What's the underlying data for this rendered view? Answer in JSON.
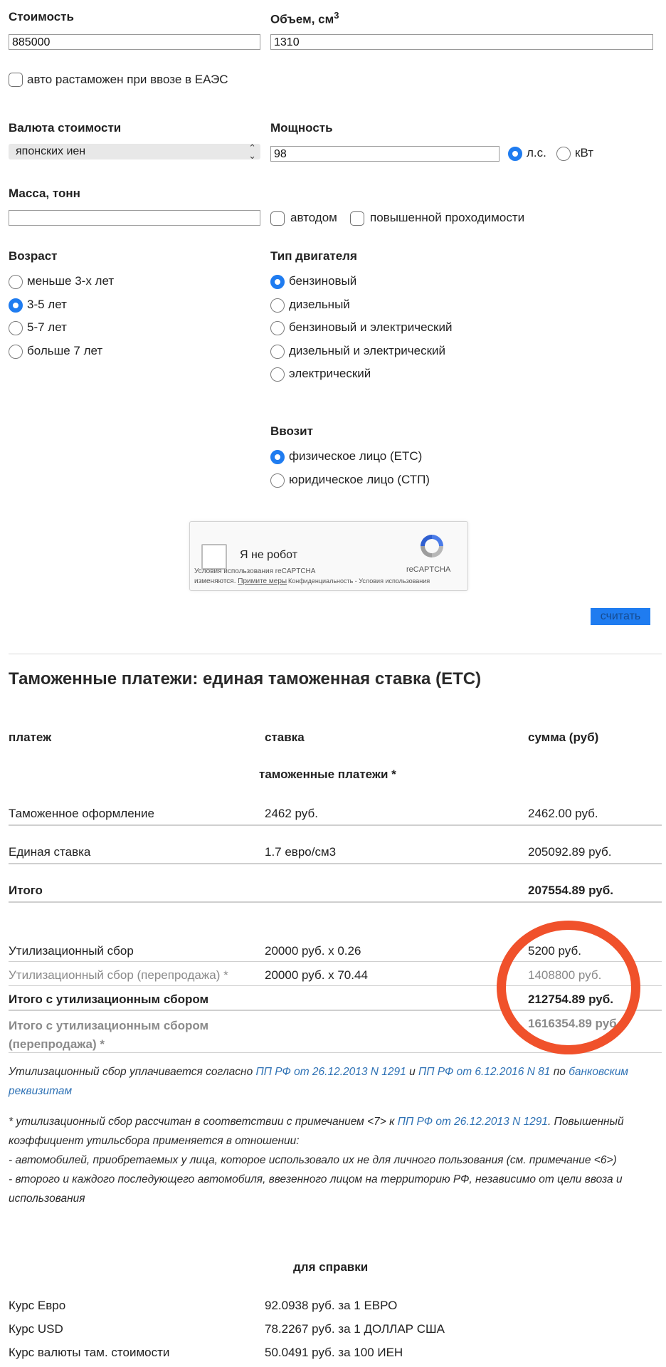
{
  "form": {
    "cost": {
      "label": "Стоимость",
      "value": "885000"
    },
    "volume": {
      "label": "Объем, см",
      "sup": "3",
      "value": "1310"
    },
    "eaes_checkbox": "авто растаможен при ввозе в ЕАЭС",
    "currency": {
      "label": "Валюта стоимости",
      "value": "японских иен"
    },
    "power": {
      "label": "Мощность",
      "value": "98",
      "unit_hp": "л.с.",
      "unit_kw": "кВт",
      "selected": "л.с."
    },
    "mass": {
      "label": "Масса, тонн",
      "value": ""
    },
    "motorhome_checkbox": "автодом",
    "offroad_checkbox": "повышенной проходимости",
    "age": {
      "label": "Возраст",
      "options": [
        "меньше 3-х лет",
        "3-5 лет",
        "5-7 лет",
        "больше 7 лет"
      ],
      "selected": "3-5 лет"
    },
    "engine": {
      "label": "Тип двигателя",
      "options": [
        "бензиновый",
        "дизельный",
        "бензиновый и электрический",
        "дизельный и электрический",
        "электрический"
      ],
      "selected": "бензиновый"
    },
    "importer": {
      "label": "Ввозит",
      "options": [
        "физическое лицо (ЕТС)",
        "юридическое лицо (СТП)"
      ],
      "selected": "физическое лицо (ЕТС)"
    },
    "recaptcha": {
      "label": "Я не робот",
      "brand": "reCAPTCHA",
      "terms_line1": "Условия использования reCAPTCHA",
      "terms_line2": "изменяются.",
      "terms_link": "Примите меры",
      "privacy": "Конфиденциальность - Условия использования"
    },
    "submit_label": "считать"
  },
  "results": {
    "title": "Таможенные платежи: единая таможенная ставка (ЕТС)",
    "headers": {
      "payment": "платеж",
      "rate": "ставка",
      "sum": "сумма (руб)"
    },
    "section_title": "таможенные платежи *",
    "rows": [
      {
        "payment": "Таможенное оформление",
        "rate": "2462 руб.",
        "sum": "2462.00 руб."
      },
      {
        "payment": "Единая ставка",
        "rate": "1.7 евро/см3",
        "sum": "205092.89 руб."
      },
      {
        "payment": "Итого",
        "rate": "",
        "sum": "207554.89 руб."
      },
      {
        "payment": "Утилизационный сбор",
        "rate": "20000 руб. x 0.26",
        "sum": "5200 руб."
      },
      {
        "payment": "Утилизационный сбор (перепродажа) *",
        "rate": "20000 руб. x 70.44",
        "sum": "1408800 руб."
      },
      {
        "payment": "Итого с утилизационным сбором",
        "rate": "",
        "sum": "212754.89 руб."
      },
      {
        "payment_line1": "Итого с утилизационным сбором",
        "payment_line2": "(перепродажа) *",
        "rate": "",
        "sum": "1616354.89 руб."
      }
    ]
  },
  "notes": {
    "n1_a": "Утилизационный сбор уплачивается согласно ",
    "n1_link1": "ПП РФ от 26.12.2013 N 1291",
    "n1_b": " и ",
    "n1_link2": "ПП РФ от 6.12.2016 N 81",
    "n1_c": " по ",
    "n1_link3": "банковским реквизитам",
    "n2_a": "* утилизационный сбор рассчитан в соответствии с примечанием <7> к ",
    "n2_link": "ПП РФ от 26.12.2013 N 1291",
    "n2_b": ". Повышенный коэффициент утильсбора применяется в отношении:",
    "n2_line2": "- автомобилей, приобретаемых у лица, которое использовало их не для личного пользования (см. примечание <6>)",
    "n2_line3": "- второго и каждого последующего автомобиля, ввезенного лицом на территорию РФ, независимо от цели ввоза и использования"
  },
  "reference": {
    "title": "для справки",
    "rows": [
      {
        "label": "Курс Евро",
        "value": "92.0938 руб. за 1 ЕВРО"
      },
      {
        "label": "Курс USD",
        "value": "78.2267 руб. за 1 ДОЛЛАР США"
      },
      {
        "label": "Курс валюты там. стоимости",
        "value": "50.0491 руб. за 100 ИЕН"
      }
    ]
  },
  "colors": {
    "accent": "#1f7cf0",
    "link": "#2f72b5",
    "highlight_circle": "#f0512b"
  }
}
